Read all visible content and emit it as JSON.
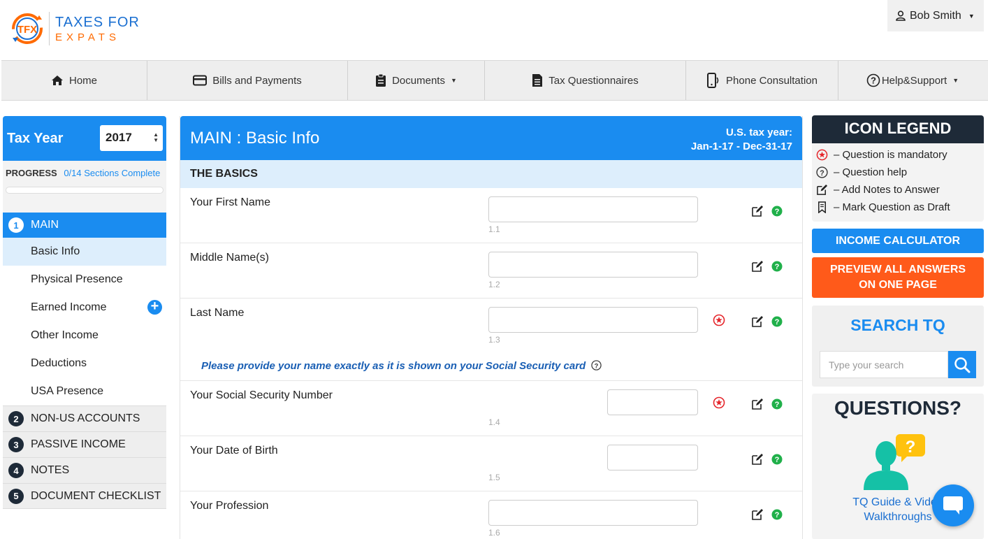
{
  "brand": {
    "line1": "TAXES FOR",
    "line2": "EXPATS",
    "mark": "TFX"
  },
  "user": {
    "name": "Bob Smith"
  },
  "nav": {
    "home": "Home",
    "bills": "Bills and Payments",
    "documents": "Documents",
    "tax_questionnaires": "Tax Questionnaires",
    "phone": "Phone Consultation",
    "help": "Help&Support"
  },
  "sidebar": {
    "tax_year_label": "Tax Year",
    "tax_year_value": "2017",
    "progress_label": "PROGRESS",
    "progress_value": "0/14 Sections Complete",
    "progress_fraction": 0,
    "main_section": {
      "num": "1",
      "label": "MAIN"
    },
    "sub_items": [
      "Basic Info",
      "Physical Presence",
      "Earned Income",
      "Other Income",
      "Deductions",
      "USA Presence"
    ],
    "sections": [
      {
        "num": "2",
        "label": "NON-US ACCOUNTS"
      },
      {
        "num": "3",
        "label": "PASSIVE INCOME"
      },
      {
        "num": "4",
        "label": "NOTES"
      },
      {
        "num": "5",
        "label": "DOCUMENT CHECKLIST"
      }
    ]
  },
  "main": {
    "title": "MAIN : Basic Info",
    "tax_year_label": "U.S. tax year:",
    "tax_year_range": "Jan-1-17 - Dec-31-17",
    "section_title": "THE BASICS",
    "questions": [
      {
        "label": "Your First Name",
        "num": "1.1",
        "mandatory": false
      },
      {
        "label": "Middle Name(s)",
        "num": "1.2",
        "mandatory": false
      },
      {
        "label": "Last Name",
        "num": "1.3",
        "mandatory": true
      },
      {
        "label": "Your Social Security Number",
        "num": "1.4",
        "mandatory": true
      },
      {
        "label": "Your Date of Birth",
        "num": "1.5",
        "mandatory": false
      },
      {
        "label": "Your Profession",
        "num": "1.6",
        "mandatory": false
      }
    ],
    "note": "Please provide your name exactly as it is shown on your Social Security card"
  },
  "legend": {
    "title": "ICON LEGEND",
    "items": [
      "– Question is mandatory",
      "– Question help",
      "– Add Notes to Answer",
      "– Mark Question as Draft"
    ]
  },
  "buttons": {
    "income_calculator": "INCOME CALCULATOR",
    "preview_line1": "PREVIEW ALL ANSWERS",
    "preview_line2": "ON ONE PAGE"
  },
  "search": {
    "title": "SEARCH TQ",
    "placeholder": "Type your search"
  },
  "questions_box": {
    "title": "QUESTIONS?",
    "link_line1": "TQ Guide & Video",
    "link_line2": "Walkthroughs"
  },
  "colors": {
    "accent": "#1a8cf0",
    "orange": "#ff5a1a",
    "dark": "#1e2a38",
    "mandatory": "#e5252b",
    "help": "#20b04a"
  }
}
